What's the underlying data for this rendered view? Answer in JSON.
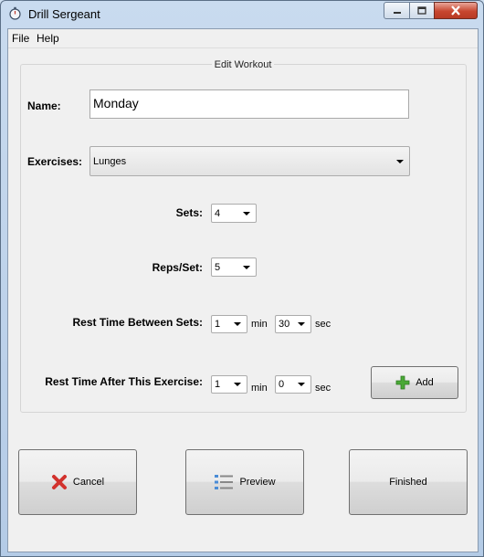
{
  "window": {
    "title": "Drill Sergeant",
    "icons": {
      "app": "stopwatch-icon",
      "minimize": "minimize-icon",
      "maximize": "maximize-icon",
      "close": "close-icon"
    }
  },
  "menu": {
    "file": "File",
    "help": "Help"
  },
  "form": {
    "group_title": "Edit Workout",
    "name_label": "Name:",
    "name_value": "Monday",
    "exercises_label": "Exercises:",
    "exercise_selected": "Lunges",
    "sets_label": "Sets:",
    "sets_value": "4",
    "reps_label": "Reps/Set:",
    "reps_value": "5",
    "rest_between_label": "Rest Time Between Sets:",
    "rest_between_min": "1",
    "rest_between_sec": "30",
    "rest_after_label": "Rest Time After This Exercise:",
    "rest_after_min": "1",
    "rest_after_sec": "0",
    "min_unit": "min",
    "sec_unit": "sec",
    "add_label": "Add",
    "add_icon": "plus-icon"
  },
  "actions": {
    "cancel_label": "Cancel",
    "cancel_icon": "x-icon",
    "preview_label": "Preview",
    "preview_icon": "list-icon",
    "finished_label": "Finished"
  },
  "colors": {
    "accent_green": "#3c9a2c",
    "cancel_red": "#d2322d",
    "window_frame": "#b4cbe6"
  }
}
